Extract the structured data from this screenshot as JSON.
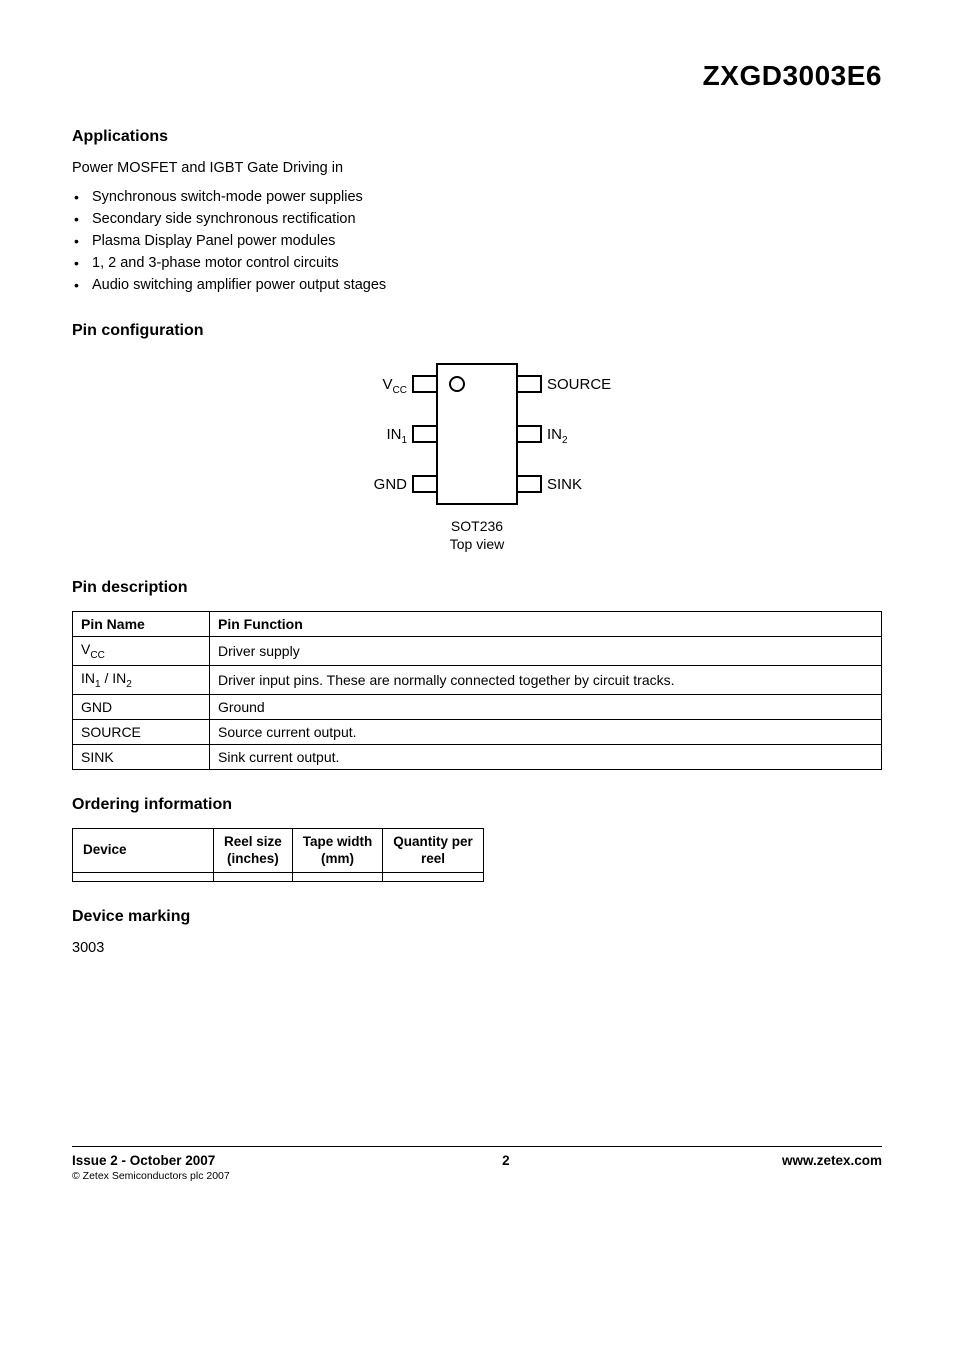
{
  "part_number": "ZXGD3003E6",
  "applications": {
    "heading": "Applications",
    "intro": "Power MOSFET and IGBT Gate Driving in",
    "items": [
      "Synchronous switch-mode power supplies",
      "Secondary side synchronous rectification",
      "Plasma Display Panel power modules",
      "1, 2 and 3-phase motor control circuits",
      "Audio switching amplifier power output stages"
    ]
  },
  "pin_config": {
    "heading": "Pin configuration",
    "left_labels": [
      "V",
      "IN",
      "GND"
    ],
    "left_subs": [
      "CC",
      "1",
      ""
    ],
    "right_labels": [
      "SOURCE",
      "IN",
      "SINK"
    ],
    "right_subs": [
      "",
      "2",
      ""
    ],
    "caption_line1": "SOT236",
    "caption_line2": "Top view"
  },
  "pin_desc": {
    "heading": "Pin description",
    "col1": "Pin Name",
    "col2": "Pin Function",
    "rows": [
      {
        "name_html": "V<sub>CC</sub>",
        "func": "Driver supply"
      },
      {
        "name_html": "IN<sub>1</sub> / IN<sub>2</sub>",
        "func": "Driver input pins. These are normally connected together by circuit tracks."
      },
      {
        "name_html": "GND",
        "func": "Ground"
      },
      {
        "name_html": "SOURCE",
        "func": "Source current output."
      },
      {
        "name_html": "SINK",
        "func": "Sink current output."
      }
    ]
  },
  "ordering": {
    "heading": "Ordering information",
    "headers": [
      "Device",
      "Reel size\n(inches)",
      "Tape width\n(mm)",
      "Quantity per\nreel"
    ],
    "row": [
      "",
      "",
      "",
      ""
    ]
  },
  "marking": {
    "heading": "Device marking",
    "code": "3003"
  },
  "footer": {
    "issue": "Issue 2 - October 2007",
    "copyright": "© Zetex Semiconductors plc 2007",
    "page": "2",
    "url": "www.zetex.com"
  }
}
